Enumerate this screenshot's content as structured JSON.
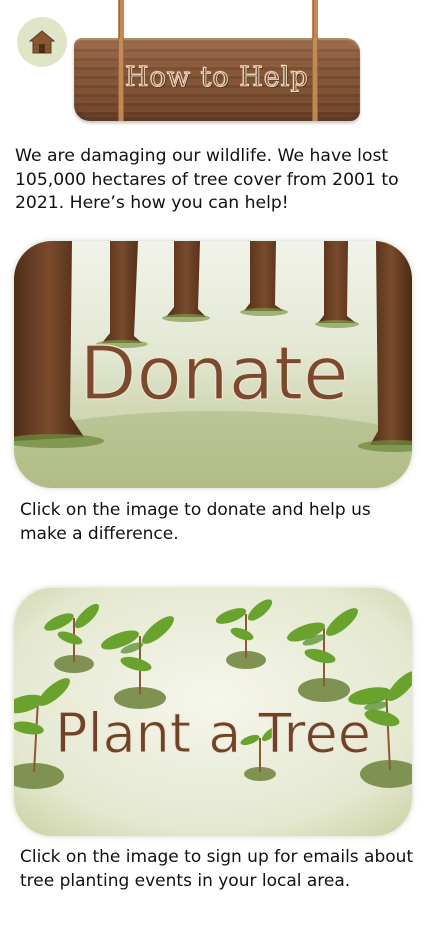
{
  "header": {
    "home_icon": "house-icon",
    "title": "How to Help"
  },
  "intro": {
    "text": "We are damaging our wildlife. We have lost 105,000 hectares of tree cover from 2001 to 2021. Here’s how you can help!"
  },
  "donate": {
    "image_label": "Donate",
    "caption": "Click on the image to donate and help us make a difference."
  },
  "plant": {
    "image_label": "Plant a Tree",
    "caption": "Click on the image to sign up for emails about tree planting events in your local area."
  },
  "colors": {
    "home_circle": "#dfe6c8",
    "wood": "#845535",
    "grass": "#b9c38f",
    "trunk": "#6e4328"
  }
}
